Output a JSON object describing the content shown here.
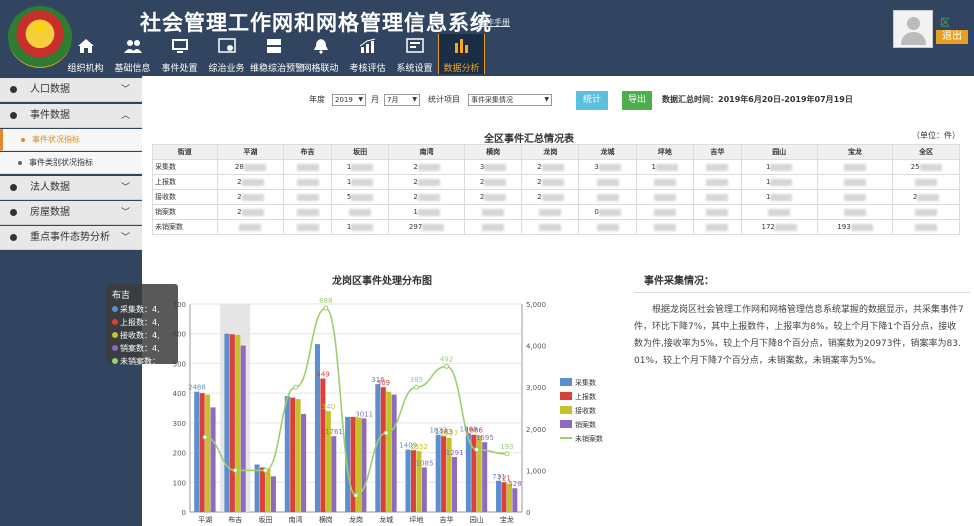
{
  "header": {
    "title": "社会管理工作网和网格管理信息系统",
    "manual_link": "操作手册",
    "area_link": "区",
    "logout": "退出"
  },
  "nav": [
    {
      "label": "组织机构",
      "icon": "home-icon"
    },
    {
      "label": "基础信息",
      "icon": "people-icon"
    },
    {
      "label": "事件处置",
      "icon": "monitor-icon"
    },
    {
      "label": "综治业务",
      "icon": "chart-icon"
    },
    {
      "label": "维稳综治预警",
      "icon": "server-icon"
    },
    {
      "label": "网格联动",
      "icon": "bell-icon"
    },
    {
      "label": "考核评估",
      "icon": "line-chart-icon"
    },
    {
      "label": "系统设置",
      "icon": "settings-icon"
    },
    {
      "label": "数据分析",
      "icon": "bar-chart-icon"
    }
  ],
  "sidebar": {
    "items": [
      {
        "label": "人口数据"
      },
      {
        "label": "事件数据"
      },
      {
        "label": "事件状况指标"
      },
      {
        "label": "事件类别状况指标"
      },
      {
        "label": "法人数据"
      },
      {
        "label": "房屋数据"
      },
      {
        "label": "重点事件态势分析"
      }
    ]
  },
  "filters": {
    "year_label": "年度",
    "year_value": "2019",
    "month_label": "月",
    "month_value": "7月",
    "item_label": "统计项目",
    "item_value": "事件采集情况",
    "stat_button": "统计",
    "export_button": "导出",
    "range_text": "数据汇总时间：2019年6月20日-2019年07月19日"
  },
  "table": {
    "title": "全区事件汇总情况表",
    "unit": "（单位：件）",
    "columns": [
      "街道",
      "平湖",
      "布吉",
      "坂田",
      "南湾",
      "横岗",
      "龙岗",
      "龙城",
      "坪地",
      "吉华",
      "园山",
      "宝龙",
      "全区"
    ],
    "rows": [
      {
        "label": "采集数",
        "cells": [
          "28",
          "",
          "1",
          "2",
          "3",
          "2",
          "3",
          "1",
          "",
          "1",
          "",
          "25"
        ]
      },
      {
        "label": "上报数",
        "cells": [
          "2",
          "",
          "1",
          "2",
          "2",
          "2",
          "",
          "",
          "",
          "1",
          "",
          ""
        ]
      },
      {
        "label": "接收数",
        "cells": [
          "2",
          "",
          "5",
          "2",
          "2",
          "2",
          "",
          "",
          "",
          "1",
          "",
          "2"
        ]
      },
      {
        "label": "销案数",
        "cells": [
          "2",
          "",
          "",
          "1",
          "",
          "",
          "0",
          "",
          "",
          "",
          "",
          ""
        ]
      },
      {
        "label": "未销案数",
        "cells": [
          "",
          "",
          "1",
          "297",
          "",
          "",
          "",
          "",
          "",
          "172",
          "193",
          ""
        ]
      }
    ]
  },
  "chart_data": {
    "type": "bar",
    "title": "龙岗区事件处理分布图",
    "categories": [
      "平湖",
      "布吉",
      "坂田",
      "南湾",
      "横岗",
      "龙岗",
      "龙城",
      "坪地",
      "吉华",
      "园山",
      "宝龙"
    ],
    "ylim": [
      0,
      700
    ],
    "y2lim": [
      0,
      5000
    ],
    "series": [
      {
        "name": "采集数",
        "color": "#5b8fd0",
        "values": [
          405,
          600,
          160,
          390,
          565,
          320,
          430,
          210,
          260,
          265,
          105
        ]
      },
      {
        "name": "上报数",
        "color": "#d9413a",
        "values": [
          400,
          598,
          150,
          385,
          449,
          320,
          420,
          208,
          255,
          260,
          100
        ]
      },
      {
        "name": "接收数",
        "color": "#c5c12a",
        "values": [
          395,
          596,
          145,
          380,
          340,
          318,
          405,
          205,
          250,
          258,
          95
        ]
      },
      {
        "name": "销案数",
        "color": "#8e6bbd",
        "values": [
          352,
          560,
          120,
          330,
          255,
          315,
          395,
          150,
          185,
          235,
          80
        ]
      },
      {
        "name": "未销案数",
        "color": "#9ccf6e",
        "type": "line",
        "axis": "right",
        "values": [
          1800,
          1000,
          1000,
          3000,
          4900,
          400,
          1900,
          3000,
          3500,
          1500,
          1400
        ]
      }
    ],
    "y_ticks": [
      0,
      100,
      200,
      300,
      400,
      500,
      600,
      700
    ],
    "y2_ticks": [
      "0",
      "1,000",
      "2,000",
      "3,000",
      "4,000",
      "5,000"
    ],
    "data_labels": [
      {
        "series": 0,
        "index": 0,
        "text": "2488"
      },
      {
        "series": 0,
        "index": 6,
        "text": "316"
      },
      {
        "series": 1,
        "index": 4,
        "text": "449"
      },
      {
        "series": 1,
        "index": 6,
        "text": "309"
      },
      {
        "series": 2,
        "index": 4,
        "text": "340"
      },
      {
        "series": 3,
        "index": 4,
        "text": "1761"
      },
      {
        "series": 3,
        "index": 5,
        "text": "3011"
      },
      {
        "series": 4,
        "index": 4,
        "text": "688"
      },
      {
        "series": 4,
        "index": 8,
        "text": "492"
      },
      {
        "series": 4,
        "index": 7,
        "text": "385"
      },
      {
        "series": 4,
        "index": 10,
        "text": "193"
      },
      {
        "series": 0,
        "index": 8,
        "text": "1822"
      },
      {
        "series": 1,
        "index": 8,
        "text": "1783"
      },
      {
        "series": 2,
        "index": 8,
        "text": "1527"
      },
      {
        "series": 3,
        "index": 8,
        "text": "1291"
      },
      {
        "series": 0,
        "index": 9,
        "text": "1868"
      },
      {
        "series": 1,
        "index": 9,
        "text": "1886"
      },
      {
        "series": 3,
        "index": 9,
        "text": "1695"
      },
      {
        "series": 0,
        "index": 7,
        "text": "1409"
      },
      {
        "series": 2,
        "index": 7,
        "text": "1352"
      },
      {
        "series": 3,
        "index": 7,
        "text": "1085"
      },
      {
        "series": 0,
        "index": 10,
        "text": "731"
      },
      {
        "series": 1,
        "index": 10,
        "text": "721"
      },
      {
        "series": 3,
        "index": 10,
        "text": "528"
      }
    ],
    "grid": true,
    "legend_position": "right"
  },
  "tooltip": {
    "title": "布吉",
    "rows": [
      {
        "label": "采集数：4,",
        "color": "#5b8fd0"
      },
      {
        "label": "上报数：4,",
        "color": "#d9413a"
      },
      {
        "label": "接收数：4,",
        "color": "#c5c12a"
      },
      {
        "label": "销案数：4,",
        "color": "#8e6bbd"
      },
      {
        "label": "未销案数：",
        "color": "#9ccf6e"
      }
    ]
  },
  "description": {
    "title": "事件采集情况：",
    "text": "根据龙岗区社会管理工作网和网格管理信息系统掌握的数据显示，共采集事件7件，环比下降7%，其中上报数件，上报率为8%，较上个月下降1个百分点，接收数为件,接收率为5%，较上个月下降8个百分点，销案数为20973件，销案率为83.01%，较上个月下降7个百分点，未销案数，未销案率为5%。"
  }
}
